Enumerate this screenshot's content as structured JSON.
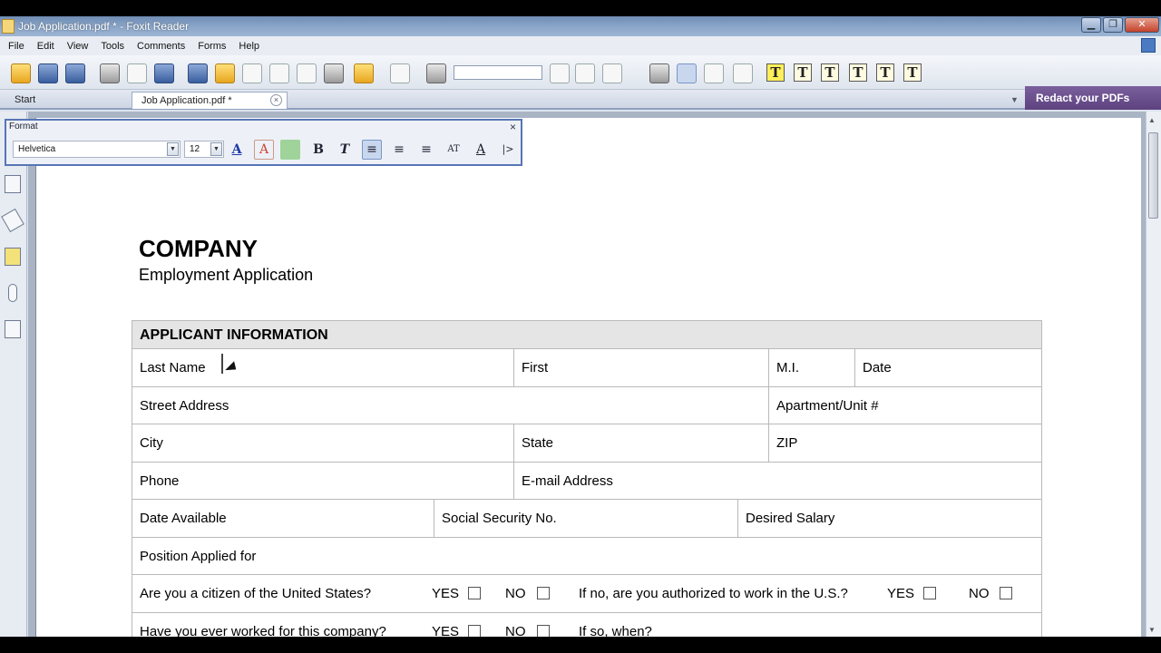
{
  "window": {
    "title": "Job Application.pdf * - Foxit Reader"
  },
  "menu": [
    "File",
    "Edit",
    "View",
    "Tools",
    "Comments",
    "Forms",
    "Help"
  ],
  "tabs": {
    "start": "Start",
    "document": "Job Application.pdf *",
    "close": "×"
  },
  "banner": {
    "redact": "Redact your PDFs"
  },
  "format_toolbar": {
    "title": "Format",
    "close": "×",
    "font": "Helvetica",
    "size": "12",
    "buttons": [
      "A",
      "A",
      "",
      "B",
      "T",
      "≡",
      "≡",
      "≡",
      "AT",
      "A",
      "|>"
    ]
  },
  "form": {
    "company": "COMPANY",
    "subtitle": "Employment Application",
    "section": "APPLICANT INFORMATION",
    "last_name": "Last Name",
    "first": "First",
    "mi": "M.I.",
    "date": "Date",
    "street": "Street Address",
    "apt": "Apartment/Unit #",
    "city": "City",
    "state": "State",
    "zip": "ZIP",
    "phone": "Phone",
    "email": "E-mail Address",
    "date_available": "Date Available",
    "ssn": "Social Security No.",
    "desired_salary": "Desired Salary",
    "position": "Position Applied for",
    "citizen_q": "Are you a citizen of the United States?",
    "yes": "YES",
    "no": "NO",
    "authorized_q": "If no, are you authorized to work in the U.S.?",
    "worked_q": "Have you ever worked for this company?",
    "if_so": "If so, when?"
  }
}
